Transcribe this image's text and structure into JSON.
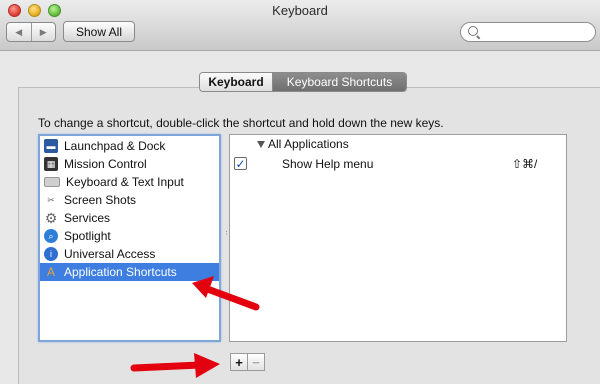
{
  "window": {
    "title": "Keyboard"
  },
  "toolbar": {
    "back": "◀",
    "forward": "▶",
    "show_all": "Show All"
  },
  "search": {
    "placeholder": ""
  },
  "tabs": [
    {
      "label": "Keyboard"
    },
    {
      "label": "Keyboard Shortcuts",
      "selected": true
    }
  ],
  "instructions": "To change a shortcut, double-click the shortcut and hold down the new keys.",
  "categories": [
    {
      "label": "Launchpad & Dock",
      "icon": "launchpad-dock-icon",
      "color": "#2c5aa0"
    },
    {
      "label": "Mission Control",
      "icon": "mission-control-icon",
      "color": "#333333"
    },
    {
      "label": "Keyboard & Text Input",
      "icon": "keyboard-icon",
      "color": "#cfcfcf"
    },
    {
      "label": "Screen Shots",
      "icon": "camera-icon",
      "color": "#8a8a8a"
    },
    {
      "label": "Services",
      "icon": "gear-icon",
      "color": "#7a7a7a"
    },
    {
      "label": "Spotlight",
      "icon": "spotlight-icon",
      "color": "#2f7fd8"
    },
    {
      "label": "Universal Access",
      "icon": "universal-access-icon",
      "color": "#2f6fd0"
    },
    {
      "label": "Application Shortcuts",
      "icon": "application-shortcuts-icon",
      "color": "#d88c1e",
      "selected": true
    }
  ],
  "shortcuts": {
    "group_label": "All Applications",
    "items": [
      {
        "label": "Show Help menu",
        "keys": "⇧⌘/",
        "checked": true
      }
    ]
  },
  "buttons": {
    "add": "+",
    "remove": "−"
  },
  "colors": {
    "selection": "#3d7ee0",
    "annotation_arrow": "#e3000f"
  }
}
